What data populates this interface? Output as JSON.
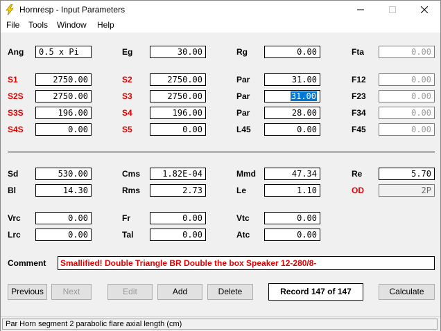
{
  "window": {
    "title": "Hornresp - Input Parameters"
  },
  "menu": {
    "file": "File",
    "tools": "Tools",
    "window": "Window",
    "help": "Help"
  },
  "params": {
    "ang_label": "Ang",
    "ang": "0.5 x Pi",
    "eg_label": "Eg",
    "eg": "30.00",
    "rg_label": "Rg",
    "rg": "0.00",
    "fta_label": "Fta",
    "fta": "0.00",
    "s1_label": "S1",
    "s1": "2750.00",
    "s2_label": "S2",
    "s2": "2750.00",
    "par1_label": "Par",
    "par1": "31.00",
    "f12_label": "F12",
    "f12": "0.00",
    "s2s_label": "S2S",
    "s2s": "2750.00",
    "s3_label": "S3",
    "s3": "2750.00",
    "par2_label": "Par",
    "par2": "31.00",
    "f23_label": "F23",
    "f23": "0.00",
    "s3s_label": "S3S",
    "s3s": "196.00",
    "s4_label": "S4",
    "s4": "196.00",
    "par3_label": "Par",
    "par3": "28.00",
    "f34_label": "F34",
    "f34": "0.00",
    "s4s_label": "S4S",
    "s4s": "0.00",
    "s5_label": "S5",
    "s5": "0.00",
    "l45_label": "L45",
    "l45": "0.00",
    "f45_label": "F45",
    "f45": "0.00",
    "sd_label": "Sd",
    "sd": "530.00",
    "cms_label": "Cms",
    "cms": "1.82E-04",
    "mmd_label": "Mmd",
    "mmd": "47.34",
    "re_label": "Re",
    "re": "5.70",
    "bl_label": "Bl",
    "bl": "14.30",
    "rms_label": "Rms",
    "rms": "2.73",
    "le_label": "Le",
    "le": "1.10",
    "od_label": "OD",
    "od": "2P",
    "vrc_label": "Vrc",
    "vrc": "0.00",
    "fr_label": "Fr",
    "fr": "0.00",
    "vtc_label": "Vtc",
    "vtc": "0.00",
    "lrc_label": "Lrc",
    "lrc": "0.00",
    "tal_label": "Tal",
    "tal": "0.00",
    "atc_label": "Atc",
    "atc": "0.00"
  },
  "comment": {
    "label": "Comment",
    "text": "Smallified! Double Triangle BR Double the box Speaker 12-280/8-"
  },
  "buttons": {
    "previous": "Previous",
    "next": "Next",
    "edit": "Edit",
    "add": "Add",
    "delete": "Delete",
    "record": "Record 147 of 147",
    "calculate": "Calculate"
  },
  "status": {
    "text": "Par   Horn segment 2 parabolic flare axial length  (cm)"
  },
  "colors": {
    "label_red": "#e00000",
    "selection": "#0078d7",
    "background": "#f0f0f0"
  },
  "icons": {
    "app": "lightning-bolt-icon"
  }
}
